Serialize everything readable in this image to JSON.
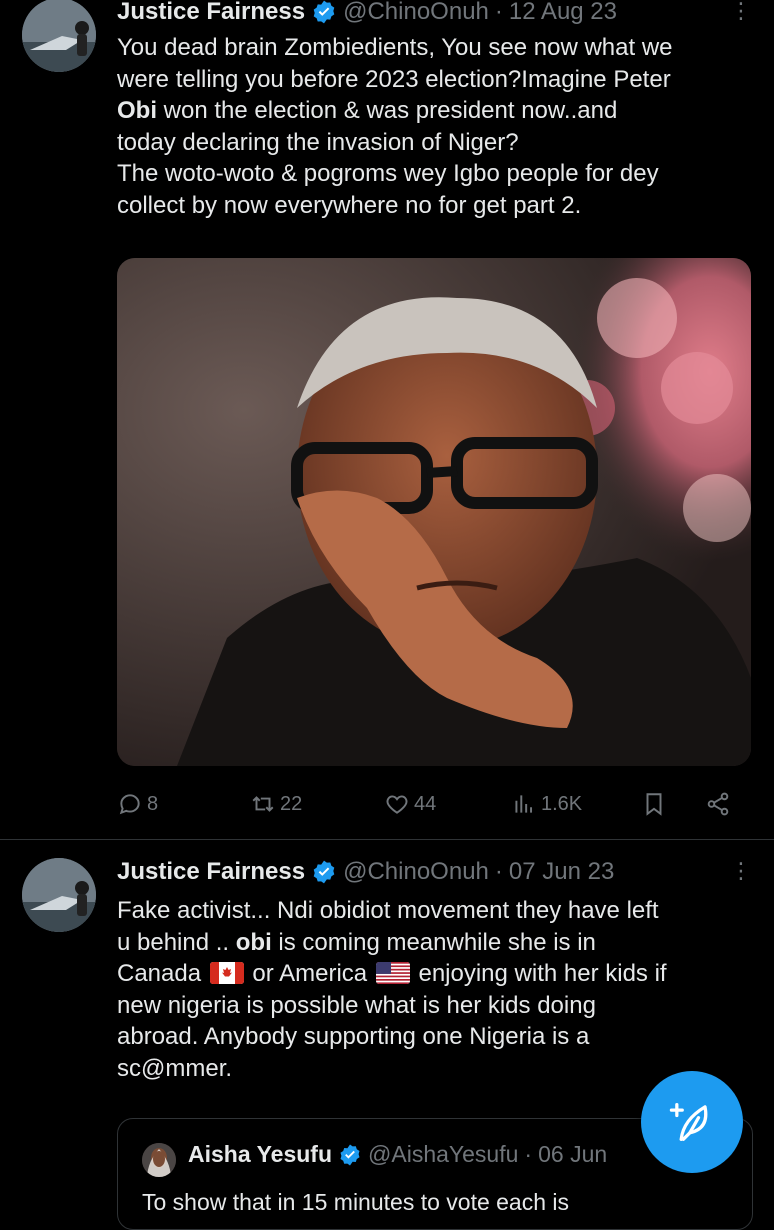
{
  "tweets": [
    {
      "name": "Justice Fairness",
      "handle": "@ChinoOnuh",
      "separator": "·",
      "date": "12 Aug 23",
      "more": "⋮",
      "text_lines": [
        "You dead brain Zombiedients, You see now what we",
        "were telling you before 2023 election?Imagine Peter",
        " won the election & was president now..and",
        "today declaring the invasion of Niger?",
        "The woto-woto & pogroms wey Igbo people for dey",
        "collect by now everywhere no for get part 2."
      ],
      "bold_word": "Obi",
      "actions": {
        "replies": "8",
        "reposts": "22",
        "likes": "44",
        "views": "1.6K"
      }
    },
    {
      "name": "Justice Fairness",
      "handle": "@ChinoOnuh",
      "separator": "·",
      "date": "07 Jun 23",
      "more": "⋮",
      "line1": "Fake activist... Ndi obidiot movement they have left",
      "line2_pre": "u behind .. ",
      "line2_bold": "obi",
      "line2_post": " is coming meanwhile she is in",
      "line3_a": "Canada ",
      "line3_b": " or America ",
      "line3_c": " enjoying with her kids if",
      "line4": "new nigeria is possible what is her kids doing",
      "line5": "abroad. Anybody supporting one Nigeria is a",
      "line6": "sc@mmer.",
      "quote": {
        "name": "Aisha Yesufu",
        "handle": "@AishaYesufu",
        "separator": "·",
        "date": "06 Jun",
        "text_partial": "To show that in 15 minutes to vote each is"
      }
    }
  ],
  "colors": {
    "background": "#000000",
    "text": "#e7e9ea",
    "muted": "#71767b",
    "accent": "#1d9bf0"
  },
  "icons": [
    "reply-icon",
    "repost-icon",
    "like-icon",
    "views-icon",
    "bookmark-icon",
    "share-icon",
    "verified-icon",
    "compose-icon"
  ]
}
